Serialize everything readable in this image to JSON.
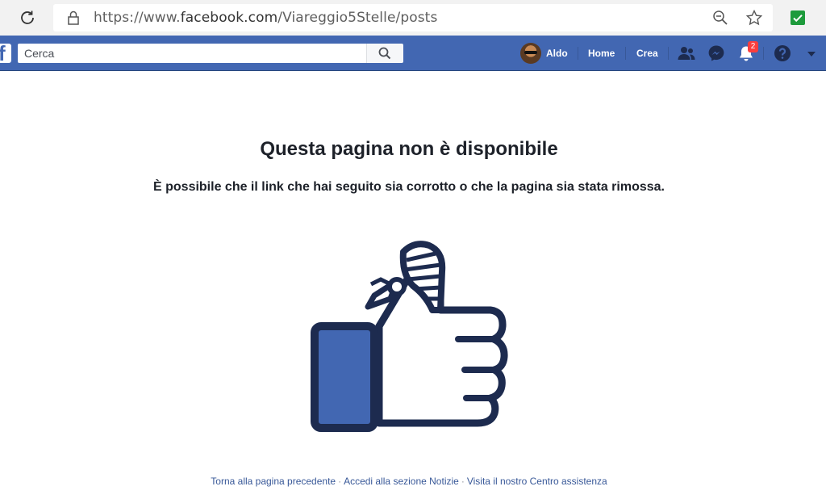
{
  "browser": {
    "url_prefix": "https://www.",
    "url_host": "facebook.com",
    "url_path": "/Viareggio5Stelle/posts"
  },
  "topbar": {
    "search_placeholder": "Cerca",
    "profile_name": "Aldo",
    "home_label": "Home",
    "create_label": "Crea",
    "notification_count": "2",
    "brand_color": "#4267b2"
  },
  "main": {
    "title": "Questa pagina non è disponibile",
    "subtitle": "È possibile che il link che hai seguito sia corrotto o che la pagina sia stata rimossa."
  },
  "footer": {
    "links": [
      "Torna alla pagina precedente",
      "Accedi alla sezione Notizie",
      "Visita il nostro Centro assistenza"
    ],
    "separator": "·"
  },
  "icons": [
    "reload-icon",
    "lock-icon",
    "zoom-icon",
    "star-icon",
    "extension-icon",
    "facebook-logo",
    "search-icon",
    "friends-icon",
    "messenger-icon",
    "notifications-icon",
    "help-icon",
    "account-menu-caret-icon",
    "bandaged-thumb-icon"
  ]
}
